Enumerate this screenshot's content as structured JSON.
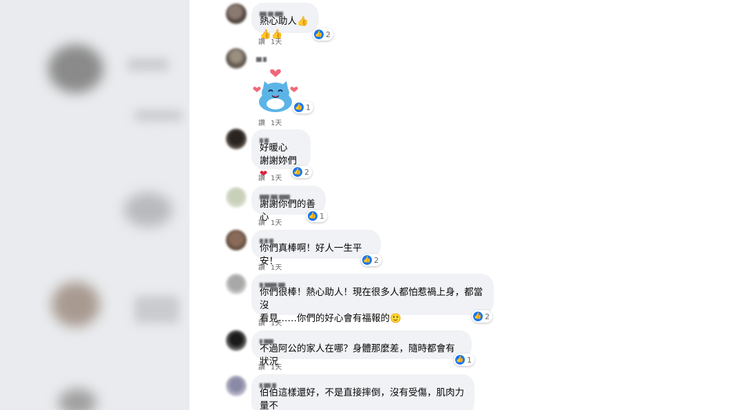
{
  "comments": [
    {
      "text": "熱心助人👍👍👍",
      "reaction_count": "2",
      "action": "讚",
      "time": "1天"
    },
    {
      "text": "",
      "reaction_count": "1",
      "action": "讚",
      "time": "1天"
    },
    {
      "text": "好暖心\n謝謝妳們",
      "reaction_count": "2",
      "action": "讚",
      "time": "1天"
    },
    {
      "text": "謝謝你們的善心",
      "reaction_count": "1",
      "action": "讚",
      "time": "1天"
    },
    {
      "text": "你們真棒啊！好人一生平安！",
      "reaction_count": "2",
      "action": "讚",
      "time": "1天"
    },
    {
      "text": "你們很棒！熱心助人！現在很多人都怕惹禍上身，都當沒\n看見……你們的好心會有福報的",
      "reaction_count": "2",
      "action": "讚",
      "time": "1天"
    },
    {
      "text": "不過阿公的家人在哪？身體那麼差，隨時都會有狀況",
      "reaction_count": "1",
      "action": "讚",
      "time": "1天"
    },
    {
      "text": "伯伯這樣還好，不是直接摔倒，沒有受傷，肌肉力量不\n夠，慢慢扶起來沒事的。有熱心的人幫忙真好",
      "reaction_count": "",
      "action": "",
      "time": ""
    }
  ],
  "colors": {
    "like": "#1877f2",
    "bubble": "#f0f2f5",
    "text": "#050505",
    "meta": "#65676b",
    "heart": "#e41e3f"
  }
}
